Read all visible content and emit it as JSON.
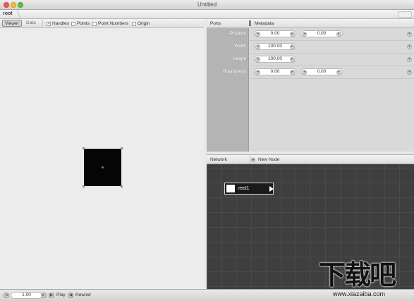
{
  "window": {
    "title": "Untitled"
  },
  "breadcrumb": {
    "root": "root",
    "right_button": "-"
  },
  "viewer": {
    "tabs": [
      {
        "label": "Viewer"
      },
      {
        "label": "Data"
      }
    ],
    "checks": [
      {
        "label": "Handles",
        "checked": true
      },
      {
        "label": "Points",
        "checked": false
      },
      {
        "label": "Point Numbers",
        "checked": false
      },
      {
        "label": "Origin",
        "checked": false
      }
    ]
  },
  "ports": {
    "title": "Ports",
    "metadata_label": "Metadata",
    "rows": [
      {
        "label": "Position",
        "values": [
          "0.00",
          "0.00"
        ]
      },
      {
        "label": "Width",
        "values": [
          "100.00"
        ]
      },
      {
        "label": "Height",
        "values": [
          "100.00"
        ]
      },
      {
        "label": "Roundness",
        "values": [
          "0.00",
          "0.00"
        ]
      }
    ]
  },
  "network": {
    "title": "Network",
    "new_node_label": "New Node",
    "node": {
      "label": "rect1"
    }
  },
  "playback": {
    "frame": "1.00",
    "play_label": "Play",
    "rewind_label": "Rewind"
  },
  "watermark": {
    "logo": "下载吧",
    "url": "www.xiazaiba.com"
  },
  "colors": {
    "node_bg": "#1a1a1a",
    "network_bg": "#3f3f3f",
    "handle": "#8a7fd6",
    "shape_fill": "#050505"
  }
}
